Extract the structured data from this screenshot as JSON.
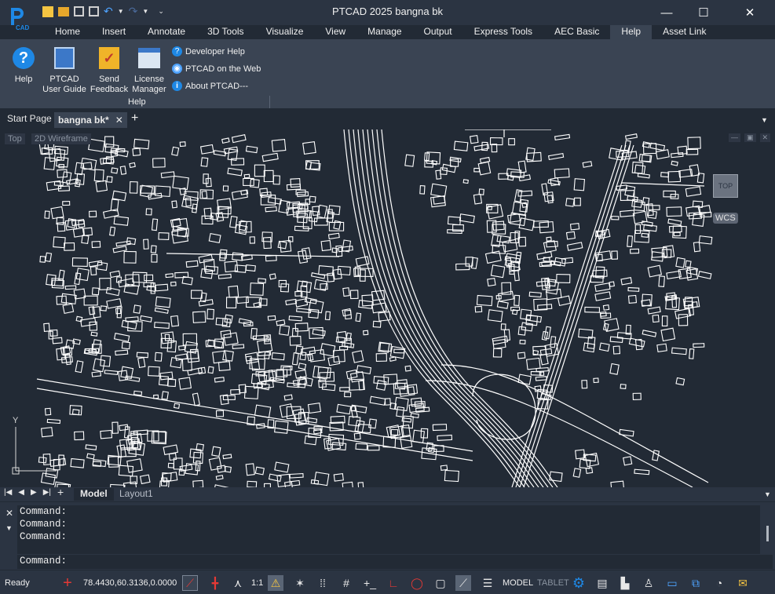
{
  "app": {
    "logo_text": "CAD",
    "title": "PTCAD  2025    bangna bk"
  },
  "window_controls": {
    "minimize": "—",
    "maximize": "☐",
    "close": "✕"
  },
  "ribbon_tabs": [
    "Home",
    "Insert",
    "Annotate",
    "3D Tools",
    "Visualize",
    "View",
    "Manage",
    "Output",
    "Express Tools",
    "AEC Basic",
    "Help",
    "Asset Link"
  ],
  "active_ribbon_tab": "Help",
  "ribbon": {
    "help_label": "Help",
    "user_guide_label_1": "PTCAD",
    "user_guide_label_2": "User Guide",
    "feedback_label_1": "Send",
    "feedback_label_2": "Feedback",
    "license_label_1": "License",
    "license_label_2": "Manager",
    "developer_help": "Developer Help",
    "on_the_web": "PTCAD on the Web",
    "about": "About PTCAD---",
    "panel_title": "Help"
  },
  "doc_tabs": {
    "start_page": "Start Page",
    "active_doc": "bangna bk*",
    "add": "+"
  },
  "viewport": {
    "view_label": "Top",
    "style_label": "2D Wireframe",
    "viewcube_label": "TOP",
    "ucs_label": "WCS",
    "axis_y": "Y"
  },
  "layout_tabs": {
    "model": "Model",
    "layout1": "Layout1"
  },
  "command": {
    "history": [
      "Command:",
      "Command:",
      "Command:"
    ],
    "prompt": "Command:"
  },
  "status": {
    "ready": "Ready",
    "coords": "78.4430,60.3136,0.0000",
    "scale": "1:1",
    "model": "MODEL",
    "tablet": "TABLET"
  },
  "colors": {
    "background": "#222a35",
    "panel": "#2b3442",
    "ribbon": "#3a4453",
    "accent_blue": "#1e88e5",
    "drawing_lines": "#ffffff"
  }
}
